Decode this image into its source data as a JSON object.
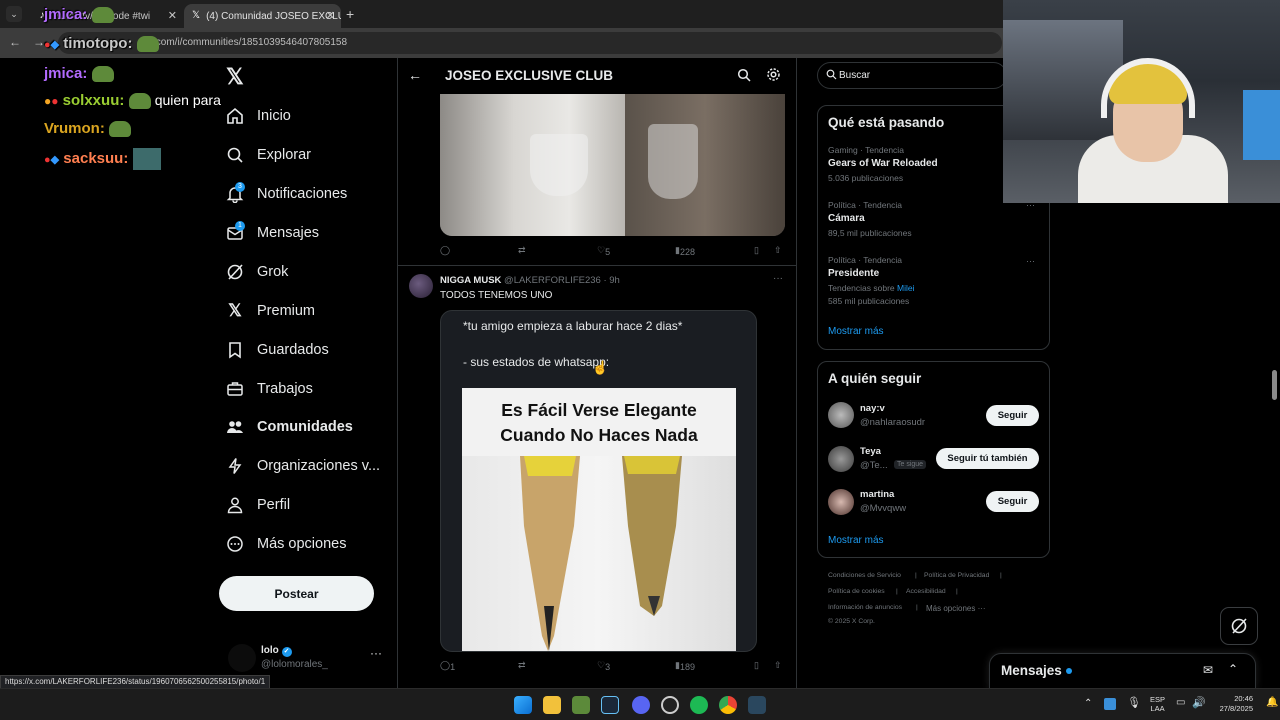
{
  "browser": {
    "tabs": [
      {
        "label": "twitch.tv/alvicode #twi",
        "active": false
      },
      {
        "label": "(4) Comunidad JOSEO EXCLUSI",
        "active": true
      }
    ],
    "url": "x.com/i/communities/1851039546407805158",
    "status_url": "https://x.com/LAKERFORLIFE236/status/1960706562500255815/photo/1"
  },
  "stream_chat": [
    {
      "user": "jmica:",
      "color": "#b36bff",
      "msg": ""
    },
    {
      "user": "timotopo:",
      "color": "#c9c9c9",
      "msg": ""
    },
    {
      "user": "jmica:",
      "color": "#b36bff",
      "msg": ""
    },
    {
      "user": "solxxuu:",
      "color": "#9acd32",
      "msg": "quien para"
    },
    {
      "user": "Vrumon:",
      "color": "#daa520",
      "msg": ""
    },
    {
      "user": "sacksuu:",
      "color": "#ff7f50",
      "msg": ""
    }
  ],
  "nav": {
    "items": [
      {
        "label": "Inicio",
        "icon": "home-icon"
      },
      {
        "label": "Explorar",
        "icon": "search-icon"
      },
      {
        "label": "Notificaciones",
        "icon": "bell-icon",
        "badge": "3"
      },
      {
        "label": "Mensajes",
        "icon": "mail-icon",
        "badge": "1"
      },
      {
        "label": "Grok",
        "icon": "grok-icon"
      },
      {
        "label": "Premium",
        "icon": "x-logo-icon"
      },
      {
        "label": "Guardados",
        "icon": "bookmark-icon"
      },
      {
        "label": "Trabajos",
        "icon": "briefcase-icon"
      },
      {
        "label": "Comunidades",
        "icon": "people-icon"
      },
      {
        "label": "Organizaciones v...",
        "icon": "lightning-icon"
      },
      {
        "label": "Perfil",
        "icon": "person-icon"
      },
      {
        "label": "Más opciones",
        "icon": "more-circle-icon"
      }
    ],
    "post_button": "Postear",
    "account": {
      "name": "lolo",
      "handle": "@lolomorales_"
    }
  },
  "community": {
    "title": "JOSEO EXCLUSIVE CLUB"
  },
  "posts": [
    {
      "stats": {
        "replies": "",
        "reposts": "",
        "likes": "5",
        "views": "228"
      }
    },
    {
      "author": "NIGGA MUSK",
      "handle": "@LAKERFORLIFE236",
      "time": "· 9h",
      "text": "TODOS TENEMOS UNO",
      "meme_line1": "*tu amigo empieza a laburar hace 2 dias*",
      "meme_line2": "- sus estados de whatsapp:",
      "meme_title": "Es Fácil Verse Elegante Cuando No Haces Nada",
      "stats": {
        "replies": "1",
        "reposts": "",
        "likes": "3",
        "views": "189"
      }
    }
  ],
  "search": {
    "placeholder": "Buscar"
  },
  "trends": {
    "title": "Qué está pasando",
    "items": [
      {
        "meta": "Gaming · Tendencia",
        "name": "Gears of War Reloaded",
        "count": "5.036 publicaciones",
        "extra": ""
      },
      {
        "meta": "Política · Tendencia",
        "name": "Cámara",
        "count": "89,5 mil publicaciones",
        "extra": ""
      },
      {
        "meta": "Política · Tendencia",
        "name": "Presidente",
        "count": "585 mil publicaciones",
        "extra": "Tendencias sobre",
        "extra_link": "Milei"
      }
    ],
    "show_more": "Mostrar más"
  },
  "who_to_follow": {
    "title": "A quién seguir",
    "users": [
      {
        "name": "nay:v",
        "handle": "@nahlaraosudr",
        "button": "Seguir",
        "follows_you": ""
      },
      {
        "name": "Teya",
        "handle": "@Te...",
        "button": "Seguir tú también",
        "follows_you": "Te sigue"
      },
      {
        "name": "martina",
        "handle": "@Mvvqww",
        "button": "Seguir",
        "follows_you": ""
      }
    ],
    "show_more": "Mostrar más"
  },
  "footer": {
    "links": [
      "Condiciones de Servicio",
      "Política de Privacidad",
      "Política de cookies",
      "Accesibilidad",
      "Información de anuncios",
      "Más opciones ···"
    ],
    "copyright": "© 2025 X Corp."
  },
  "messages_drawer": {
    "label": "Mensajes"
  },
  "taskbar": {
    "lang1": "ESP",
    "lang2": "LAA",
    "time": "20:46",
    "date": "27/8/2025"
  },
  "colors": {
    "accent": "#1d9bf0",
    "background": "#000000",
    "border": "#2f3336"
  }
}
